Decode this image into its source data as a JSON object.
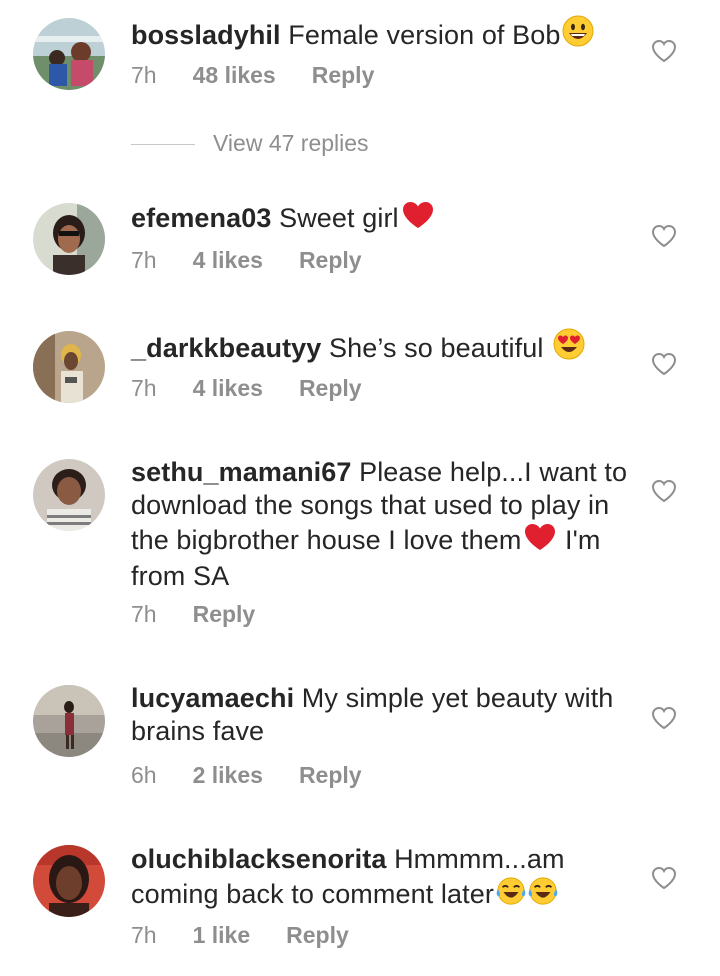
{
  "comments": [
    {
      "username": "bossladyhil",
      "text": " Female version of Bob",
      "time": "7h",
      "likes": "48 likes",
      "reply": "Reply"
    },
    {
      "username": "efemena03",
      "text": " Sweet girl",
      "time": "7h",
      "likes": "4 likes",
      "reply": "Reply"
    },
    {
      "username": "_darkkbeautyy",
      "text": " She’s so beautiful ",
      "time": "7h",
      "likes": "4 likes",
      "reply": "Reply"
    },
    {
      "username": "sethu_mamani67",
      "text": " Please help...I want to download the songs that used to play in the bigbrother house I love them",
      "text_tail": " I'm from SA",
      "time": "7h",
      "reply": "Reply"
    },
    {
      "username": "lucyamaechi",
      "text": " My simple yet beauty with brains fave",
      "time": "6h",
      "likes": "2 likes",
      "reply": "Reply"
    },
    {
      "username": "oluchiblacksenorita",
      "text": " Hmmmm...am coming back to comment later",
      "time": "7h",
      "likes": "1 like",
      "reply": "Reply"
    }
  ],
  "view_replies": "View 47 replies",
  "colors": {
    "text": "#262626",
    "meta": "#8e8e8e",
    "heart_red": "#e0202e"
  },
  "icons": [
    "heart-outline-icon",
    "grinning-face-emoji",
    "red-heart-emoji",
    "heart-eyes-emoji",
    "tears-of-joy-emoji"
  ]
}
